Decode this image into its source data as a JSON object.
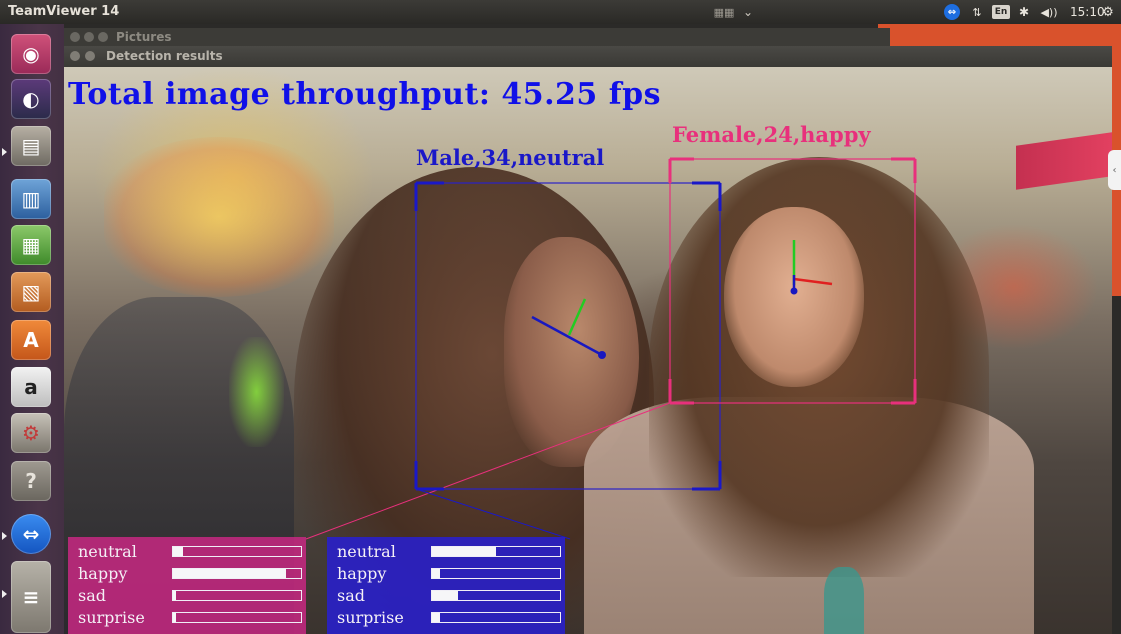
{
  "top_panel": {
    "app_title": "TeamViewer 14",
    "keyboard_layout": "En",
    "clock": "15:10"
  },
  "background_window": {
    "title": "Pictures"
  },
  "detection_window": {
    "title": "Detection results",
    "throughput_text": "Total image throughput: 45.25 fps",
    "faces": [
      {
        "label": "Male,34,neutral",
        "color": "#1a18c8",
        "emotions": [
          {
            "name": "neutral",
            "value": 0.5
          },
          {
            "name": "happy",
            "value": 0.06
          },
          {
            "name": "sad",
            "value": 0.2
          },
          {
            "name": "surprise",
            "value": 0.06
          }
        ]
      },
      {
        "label": "Female,24,happy",
        "color": "#e8307c",
        "emotions": [
          {
            "name": "neutral",
            "value": 0.08
          },
          {
            "name": "happy",
            "value": 0.88
          },
          {
            "name": "sad",
            "value": 0.02
          },
          {
            "name": "surprise",
            "value": 0.02
          }
        ]
      }
    ]
  },
  "launcher": {
    "items": [
      {
        "name": "ubuntu-dash",
        "glyph": "◉"
      },
      {
        "name": "firefox",
        "glyph": "◐"
      },
      {
        "name": "files",
        "glyph": "▤"
      },
      {
        "name": "writer",
        "glyph": "▥"
      },
      {
        "name": "calc",
        "glyph": "▦"
      },
      {
        "name": "impress",
        "glyph": "▧"
      },
      {
        "name": "software-center",
        "glyph": "A"
      },
      {
        "name": "amazon",
        "glyph": "a"
      },
      {
        "name": "system-settings",
        "glyph": "⚙"
      },
      {
        "name": "help",
        "glyph": "?"
      },
      {
        "name": "teamviewer",
        "glyph": "⇔"
      },
      {
        "name": "trash-stack",
        "glyph": "≡"
      }
    ]
  }
}
